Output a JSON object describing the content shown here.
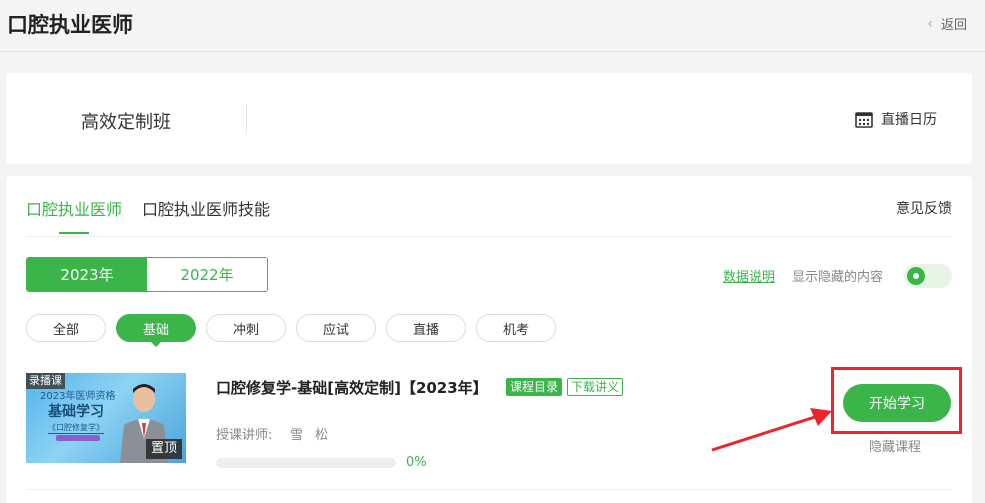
{
  "header": {
    "title": "口腔执业医师",
    "back_label": "返回"
  },
  "class_card": {
    "name": "高效定制班",
    "calendar_label": "直播日历"
  },
  "tabs": [
    {
      "label": "口腔执业医师",
      "active": true
    },
    {
      "label": "口腔执业医师技能",
      "active": false
    }
  ],
  "feedback_label": "意见反馈",
  "years": [
    {
      "label": "2023年",
      "active": true
    },
    {
      "label": "2022年",
      "active": false
    }
  ],
  "data_desc_label": "数据说明",
  "show_hidden_label": "显示隐藏的内容",
  "toggle_on": true,
  "filters": [
    {
      "label": "全部",
      "active": false
    },
    {
      "label": "基础",
      "active": true
    },
    {
      "label": "冲刺",
      "active": false
    },
    {
      "label": "应试",
      "active": false
    },
    {
      "label": "直播",
      "active": false
    },
    {
      "label": "机考",
      "active": false
    }
  ],
  "course": {
    "thumb_tag": "录播课",
    "thumb_line1": "2023年医师资格",
    "thumb_line2": "基础学习",
    "thumb_line3": "《口腔修复学》",
    "pin_label": "置顶",
    "title": "口腔修复学-基础[高效定制]【2023年】",
    "catalog_label": "课程目录",
    "download_label": "下载讲义",
    "teacher_label": "授课讲师:",
    "teacher_name": "雪松",
    "progress": 0,
    "progress_text": "0%",
    "start_label": "开始学习",
    "hide_label": "隐藏课程"
  },
  "colors": {
    "accent": "#3bb54a",
    "highlight": "#e8262c"
  }
}
